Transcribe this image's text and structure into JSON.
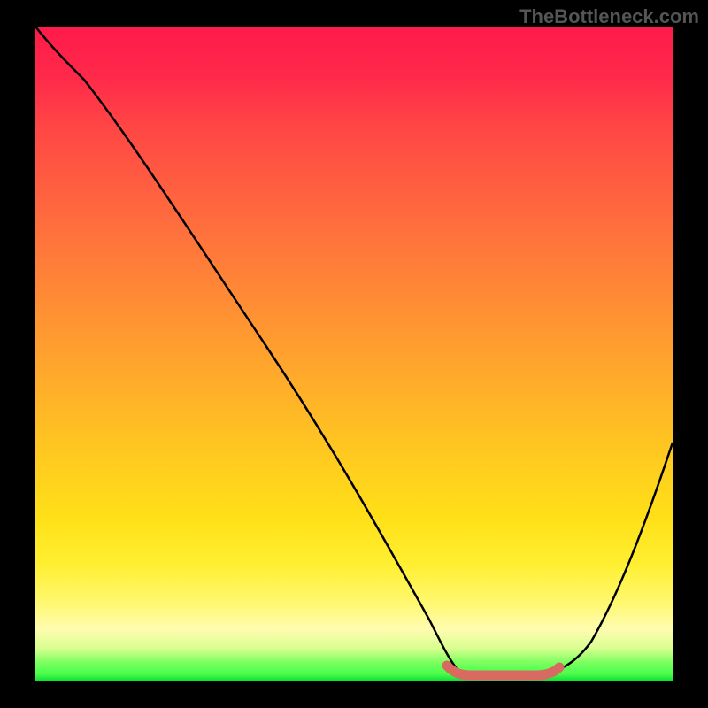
{
  "watermark": "TheBottleneck.com",
  "chart_data": {
    "type": "line",
    "title": "",
    "xlabel": "",
    "ylabel": "",
    "xlim": [
      0,
      100
    ],
    "ylim": [
      0,
      100
    ],
    "x": [
      0,
      6,
      12,
      20,
      30,
      40,
      50,
      58,
      63,
      67,
      70,
      73,
      76,
      80,
      85,
      90,
      95,
      100
    ],
    "values": [
      100,
      97,
      93,
      84,
      70,
      56,
      42,
      28,
      17,
      8,
      2,
      0,
      0,
      0,
      3,
      12,
      25,
      40
    ],
    "marker_region": {
      "x_start": 63,
      "x_end": 83,
      "color": "#d96a62",
      "description": "flat minimum segment highlighted with thick salmon stroke"
    },
    "background_gradient": {
      "top": "#ff1a4a",
      "mid": "#ffc820",
      "bottom": "#20ff40"
    },
    "curve_color": "#000000"
  }
}
